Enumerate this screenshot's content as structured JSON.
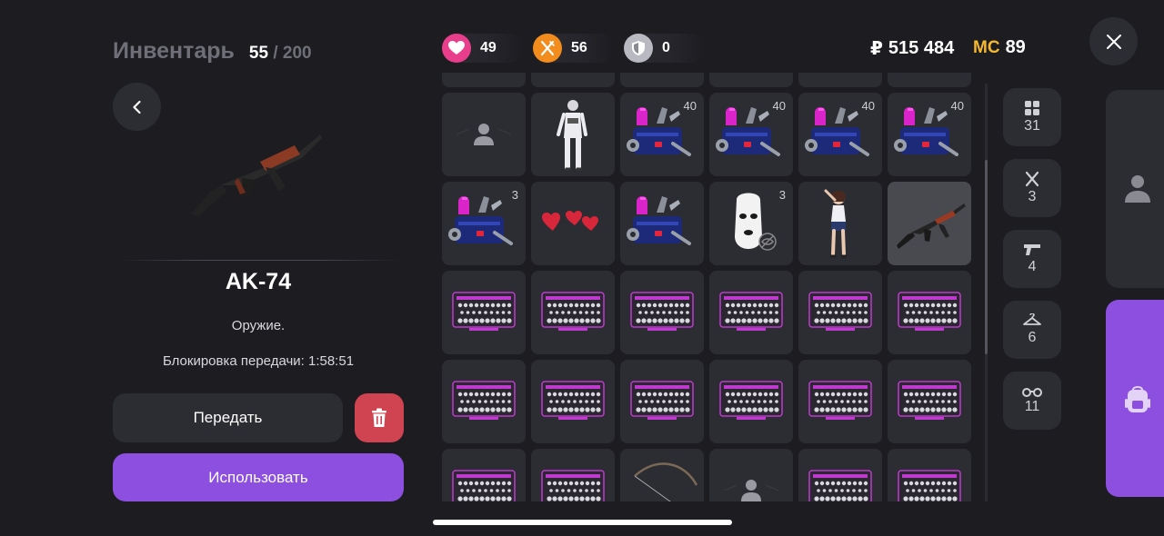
{
  "header": {
    "title": "Инвентарь",
    "count": "55",
    "separator": "/",
    "max": "200"
  },
  "selected_item": {
    "name": "AK-74",
    "type": "Оружие.",
    "lock_text": "Блокировка передачи: 1:58:51",
    "transfer_label": "Передать",
    "use_label": "Использовать"
  },
  "stats": [
    {
      "icon": "heart-icon",
      "value": "49",
      "color": "#e83e8c"
    },
    {
      "icon": "fork-knife-icon",
      "value": "56",
      "color": "#f28c1c"
    },
    {
      "icon": "shield-icon",
      "value": "0",
      "color": "#b9b9c1"
    }
  ],
  "currency": {
    "rub_symbol": "₽",
    "rub_value": "515 484",
    "mc_label": "MC",
    "mc_value": "89"
  },
  "inventory": [
    {
      "icon": "avatar-placeholder-icon",
      "qty": ""
    },
    {
      "icon": "white-outfit-skin-icon",
      "qty": ""
    },
    {
      "icon": "toolbox-icon",
      "qty": "40"
    },
    {
      "icon": "toolbox-icon",
      "qty": "40"
    },
    {
      "icon": "toolbox-icon",
      "qty": "40"
    },
    {
      "icon": "toolbox-icon",
      "qty": "40"
    },
    {
      "icon": "toolbox-icon",
      "qty": "3"
    },
    {
      "icon": "hearts-icon",
      "qty": ""
    },
    {
      "icon": "toolbox-icon",
      "qty": ""
    },
    {
      "icon": "balaclava-mask-icon",
      "qty": "3"
    },
    {
      "icon": "girl-skin-icon",
      "qty": ""
    },
    {
      "icon": "ak74-icon",
      "qty": "",
      "selected": true
    },
    {
      "icon": "socket-set-icon",
      "qty": ""
    },
    {
      "icon": "socket-set-icon",
      "qty": ""
    },
    {
      "icon": "socket-set-icon",
      "qty": ""
    },
    {
      "icon": "socket-set-icon",
      "qty": ""
    },
    {
      "icon": "socket-set-icon",
      "qty": ""
    },
    {
      "icon": "socket-set-icon",
      "qty": ""
    },
    {
      "icon": "socket-set-icon",
      "qty": ""
    },
    {
      "icon": "socket-set-icon",
      "qty": ""
    },
    {
      "icon": "socket-set-icon",
      "qty": ""
    },
    {
      "icon": "socket-set-icon",
      "qty": ""
    },
    {
      "icon": "socket-set-icon",
      "qty": ""
    },
    {
      "icon": "socket-set-icon",
      "qty": ""
    },
    {
      "icon": "socket-set-icon",
      "qty": ""
    },
    {
      "icon": "socket-set-icon",
      "qty": ""
    },
    {
      "icon": "bow-icon",
      "qty": ""
    },
    {
      "icon": "avatar-placeholder-icon",
      "qty": ""
    },
    {
      "icon": "socket-set-icon",
      "qty": ""
    },
    {
      "icon": "socket-set-icon",
      "qty": ""
    }
  ],
  "categories": [
    {
      "icon": "grid-icon",
      "count": "31"
    },
    {
      "icon": "fork-knife-icon",
      "count": "3"
    },
    {
      "icon": "pistol-icon",
      "count": "4"
    },
    {
      "icon": "hanger-icon",
      "count": "6"
    },
    {
      "icon": "glasses-icon",
      "count": "11"
    }
  ],
  "side_tabs": [
    {
      "icon": "person-icon",
      "active": false
    },
    {
      "icon": "backpack-icon",
      "active": true
    }
  ]
}
